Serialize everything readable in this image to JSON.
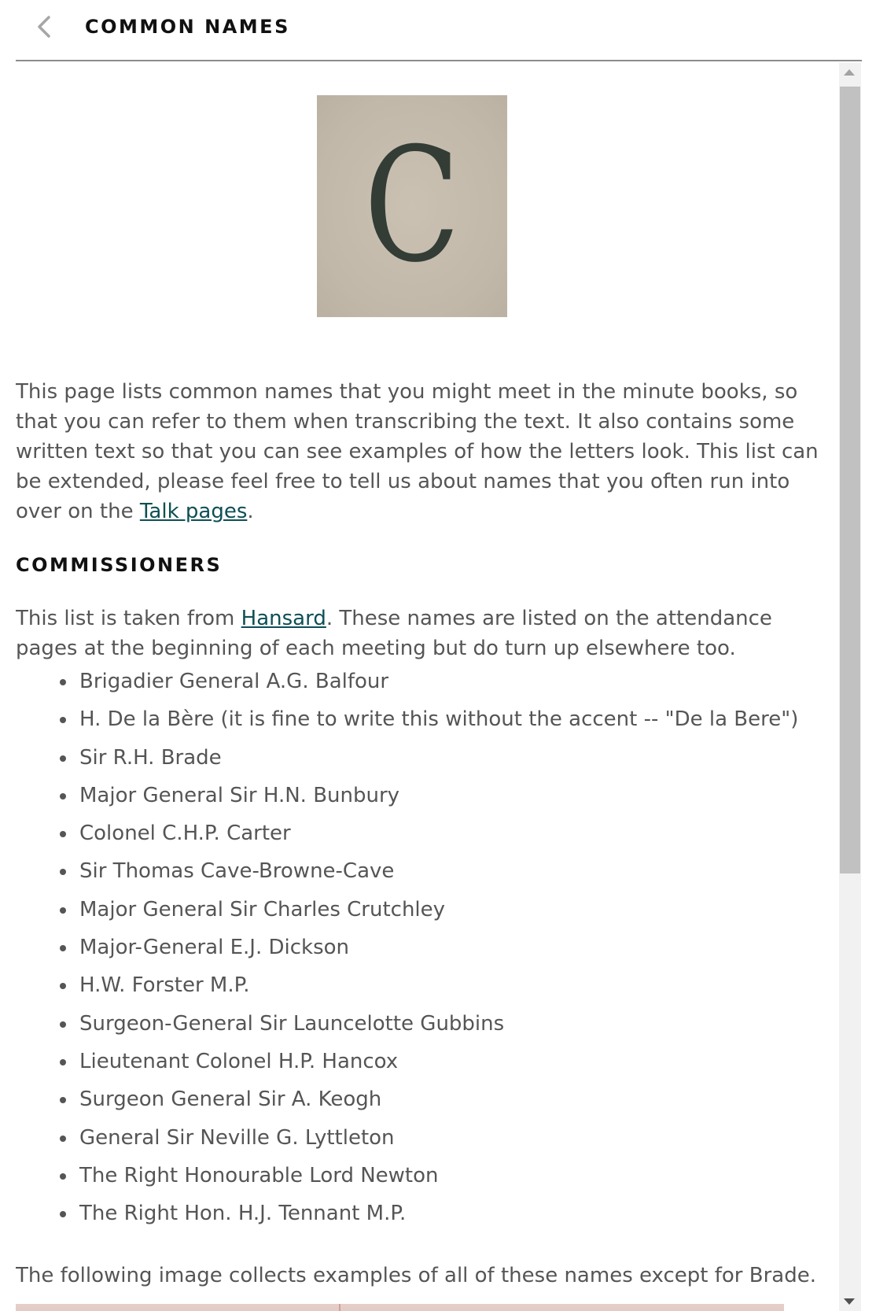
{
  "header": {
    "back_icon": "chevron-left-icon",
    "title": "COMMON NAMES"
  },
  "hero_image": {
    "letter": "C"
  },
  "intro": {
    "text_before_link": "This page lists common names that you might meet in the minute books, so that you can refer to them when transcribing the text. It also contains some written text so that you can see examples of how the letters look. This list can be extended, please feel free to tell us about names that you often run into over on the ",
    "link_text": "Talk pages",
    "text_after_link": "."
  },
  "commissioners": {
    "heading": "COMMISSIONERS",
    "intro_before_link": "This list is taken from ",
    "link_text": "Hansard",
    "intro_after_link": ". These names are listed on the attendance pages at the beginning of each meeting but do turn up elsewhere too.",
    "names": [
      "Brigadier General A.G. Balfour",
      "H. De la Bère (it is fine to write this without the accent -- \"De la Bere\")",
      "Sir R.H. Brade",
      "Major General Sir H.N. Bunbury",
      "Colonel C.H.P. Carter",
      "Sir Thomas Cave-Browne-Cave",
      "Major General Sir Charles Crutchley",
      "Major-General E.J. Dickson",
      "H.W. Forster M.P.",
      "Surgeon-General Sir Launcelotte Gubbins",
      "Lieutenant Colonel H.P. Hancox",
      "Surgeon General Sir A. Keogh",
      "General Sir Neville G. Lyttleton",
      "The Right Honourable Lord Newton",
      "The Right Hon. H.J. Tennant M.P."
    ],
    "following_text": "The following image collects examples of all of these names except for Brade."
  },
  "colors": {
    "link": "#0d4f55",
    "body_text": "#555555",
    "heading_text": "#111111",
    "scrollbar_thumb": "#c1c1c1"
  }
}
